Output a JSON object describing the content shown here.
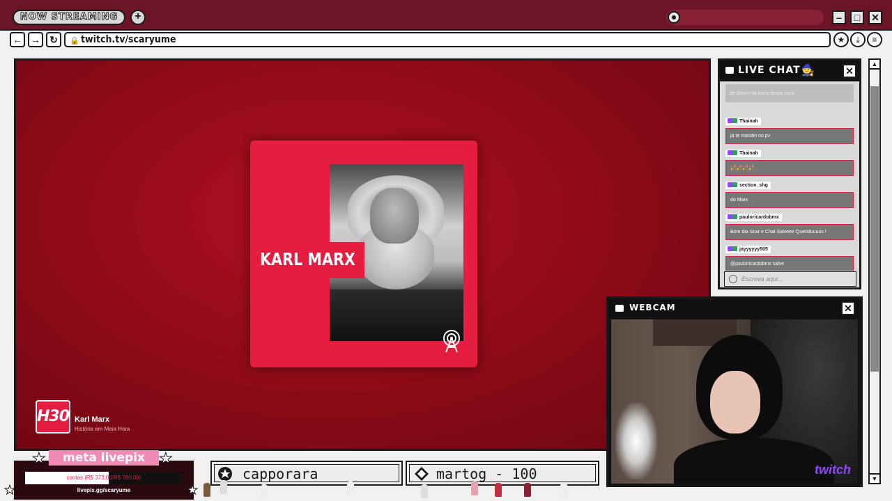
{
  "titlebar": {
    "badge": "NOW STREAMING",
    "plus": "+"
  },
  "window_controls": {
    "minimize": "–",
    "maximize": "□",
    "close": "✕"
  },
  "address": {
    "url": "twitch.tv/scaryume",
    "back": "←",
    "forward": "→",
    "reload": "↻"
  },
  "video": {
    "card_title": "KARL MARX",
    "logo": "H30",
    "episode_title": "Karl Marx",
    "episode_subtitle": "História em Meia Hora"
  },
  "chat": {
    "title": "LIVE CHAT",
    "close": "✕",
    "faded_message": "de 60mm na boca desse cara",
    "messages": [
      {
        "user": "Thainah",
        "text": "ja te mandei no pv"
      },
      {
        "user": "Thainah",
        "text": "🎉🎉🎉🎉"
      },
      {
        "user": "section_shg",
        "text": "do Marx"
      },
      {
        "user": "pauloricardobmx",
        "text": "Bom dia Scar e Chat Salveee Queriduuuus !"
      },
      {
        "user": "jayyyyyy505",
        "text": "@pauloricardobmx salve"
      }
    ],
    "input_placeholder": "Escreva aqui..."
  },
  "webcam": {
    "title": "WEBCAM",
    "close": "✕",
    "logo": "twitch"
  },
  "scrollbar": {
    "up": "▲",
    "down": "▼"
  },
  "livepix": {
    "title": "meta livepix",
    "progress_text": "contas (R$ 373,00/R$ 700,00)",
    "progress_fraction": 0.533,
    "url": "livepix.gg/scaryume"
  },
  "tickers": [
    {
      "text": "capporara"
    },
    {
      "text": "martog - 100"
    }
  ],
  "colors": {
    "accent": "#e51d40",
    "frame": "#1a1a1a",
    "twitch": "#9146ff"
  }
}
